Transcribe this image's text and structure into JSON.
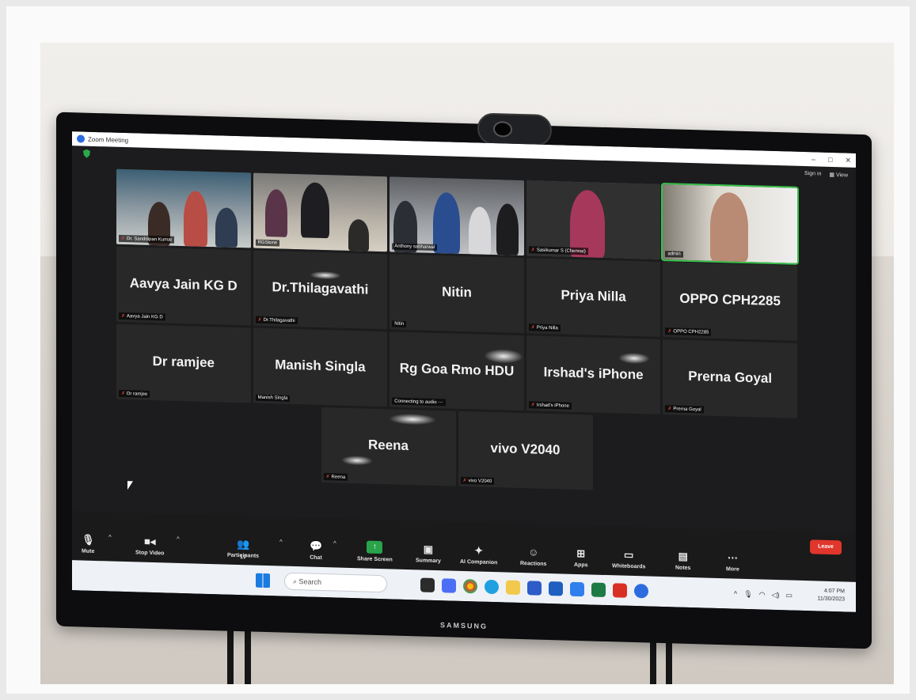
{
  "window": {
    "title": "Zoom Meeting",
    "sign_in": "Sign in",
    "view": "View"
  },
  "video_tiles": [
    {
      "name": "Dr. Sanddipan Kumar"
    },
    {
      "name": "RGStone"
    },
    {
      "name": "Anthony sabharwal"
    },
    {
      "name": "Sasikumar S (Chennai)"
    },
    {
      "name": "admin"
    }
  ],
  "name_tiles_row2": [
    {
      "display": "Aavya Jain KG D",
      "tag": "Aavya Jain KG D",
      "muted": true
    },
    {
      "display": "Dr.Thilagavathi",
      "tag": "Dr.Thilagavathi",
      "muted": true
    },
    {
      "display": "Nitin",
      "tag": "Nitin",
      "muted": false
    },
    {
      "display": "Priya Nilla",
      "tag": "Priya Nilla",
      "muted": true
    },
    {
      "display": "OPPO CPH2285",
      "tag": "OPPO CPH2285",
      "muted": true
    }
  ],
  "name_tiles_row3": [
    {
      "display": "Dr ramjee",
      "tag": "Dr ramjee",
      "muted": true
    },
    {
      "display": "Manish Singla",
      "tag": "Manish Singla",
      "muted": false
    },
    {
      "display": "Rg Goa Rmo HDU",
      "tag": "Connecting to audio",
      "muted": false
    },
    {
      "display": "Irshad's iPhone",
      "tag": "Irshad's iPhone",
      "muted": true
    },
    {
      "display": "Prerna Goyal",
      "tag": "Prerna Goyal",
      "muted": true
    }
  ],
  "name_tiles_row4": [
    {
      "display": "Reena",
      "tag": "Reena",
      "muted": true
    },
    {
      "display": "vivo V2040",
      "tag": "vivo V2040",
      "muted": true
    }
  ],
  "toolbar": {
    "mute": "Mute",
    "stop_video": "Stop Video",
    "participants": "Participants",
    "participants_count": "17",
    "chat": "Chat",
    "share_screen": "Share Screen",
    "summary": "Summary",
    "ai_companion": "AI Companion",
    "reactions": "Reactions",
    "apps": "Apps",
    "whiteboards": "Whiteboards",
    "notes": "Notes",
    "more": "More",
    "leave": "Leave"
  },
  "taskbar": {
    "search_placeholder": "Search",
    "time": "4:07 PM",
    "date": "11/30/2023"
  },
  "monitor_brand": "SAMSUNG",
  "colors": {
    "leave": "#e0362c",
    "share": "#2aa34a",
    "muted_mic": "#e0453a"
  }
}
